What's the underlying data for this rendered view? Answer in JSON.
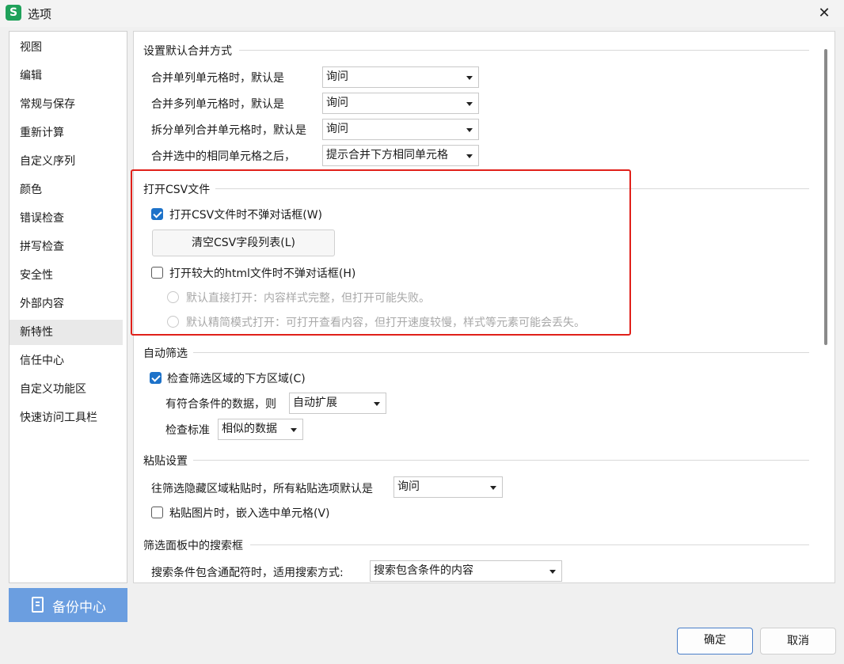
{
  "window": {
    "app_icon_letter": "S",
    "title": "选项",
    "close_glyph": "✕"
  },
  "sidebar": {
    "items": [
      {
        "label": "视图"
      },
      {
        "label": "编辑"
      },
      {
        "label": "常规与保存"
      },
      {
        "label": "重新计算"
      },
      {
        "label": "自定义序列"
      },
      {
        "label": "颜色"
      },
      {
        "label": "错误检查"
      },
      {
        "label": "拼写检查"
      },
      {
        "label": "安全性"
      },
      {
        "label": "外部内容"
      },
      {
        "label": "新特性",
        "selected": true
      },
      {
        "label": "信任中心"
      },
      {
        "label": "自定义功能区"
      },
      {
        "label": "快速访问工具栏"
      }
    ],
    "backup_label": "备份中心"
  },
  "merge": {
    "title": "设置默认合并方式",
    "row1_label": "合并单列单元格时，默认是",
    "row1_value": "询问",
    "row2_label": "合并多列单元格时，默认是",
    "row2_value": "询问",
    "row3_label": "拆分单列合并单元格时，默认是",
    "row3_value": "询问",
    "row4_label": "合并选中的相同单元格之后，",
    "row4_value": "提示合并下方相同单元格"
  },
  "csv": {
    "title": "打开CSV文件",
    "no_dialog_label": "打开CSV文件时不弹对话框(W)",
    "no_dialog_checked": true,
    "clear_button": "清空CSV字段列表(L)",
    "html_label": "打开较大的html文件时不弹对话框(H)",
    "html_checked": false,
    "radio1_label": "默认直接打开：内容样式完整，但打开可能失败。",
    "radio2_label": "默认精简模式打开：可打开查看内容，但打开速度较慢，样式等元素可能会丢失。"
  },
  "autofilter": {
    "title": "自动筛选",
    "check_label": "检查筛选区域的下方区域(C)",
    "check_checked": true,
    "condition_label": "有符合条件的数据，则",
    "condition_value": "自动扩展",
    "standard_label": "检查标准",
    "standard_value": "相似的数据"
  },
  "paste": {
    "title": "粘贴设置",
    "hidden_label": "往筛选隐藏区域粘贴时，所有粘贴选项默认是",
    "hidden_value": "询问",
    "embed_label": "粘贴图片时，嵌入选中单元格(V)",
    "embed_checked": false
  },
  "search": {
    "title": "筛选面板中的搜索框",
    "wildcard_label": "搜索条件包含通配符时，适用搜索方式:",
    "wildcard_value": "搜索包含条件的内容"
  },
  "footer": {
    "ok_label": "确定",
    "cancel_label": "取消"
  },
  "colors": {
    "accent": "#1d72c9",
    "highlight": "#e0201a",
    "backup": "#6b9ee0",
    "app_icon": "#1fa15a"
  }
}
